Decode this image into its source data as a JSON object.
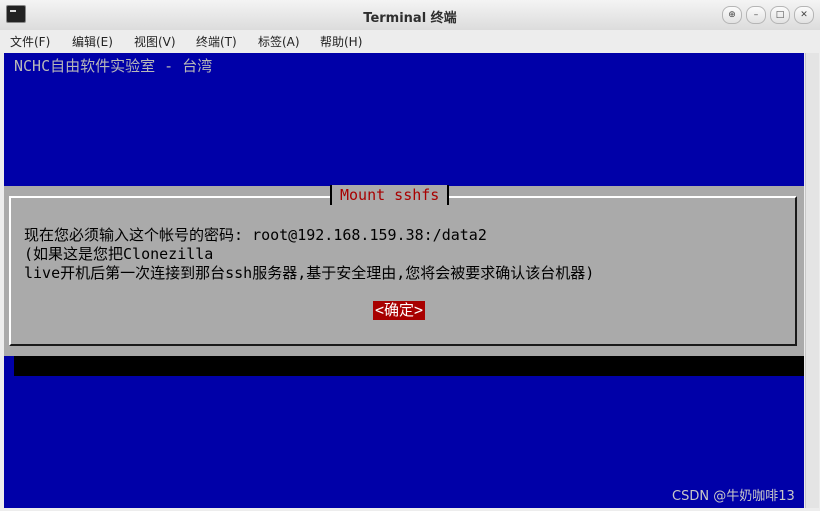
{
  "window": {
    "title": "Terminal 终端",
    "buttons": {
      "up": "⊕",
      "minimize": "–",
      "maximize": "□",
      "close": "✕"
    }
  },
  "menu": [
    "文件(F)",
    "编辑(E)",
    "视图(V)",
    "终端(T)",
    "标签(A)",
    "帮助(H)"
  ],
  "terminal": {
    "backtitle": "NCHC自由软件实验室 - 台湾",
    "dialog": {
      "title": "Mount sshfs",
      "lines": [
        "现在您必须输入这个帐号的密码: root@192.168.159.38:/data2",
        "(如果这是您把Clonezilla",
        "live开机后第一次连接到那台ssh服务器,基于安全理由,您将会被要求确认该台机器)"
      ],
      "ok_label": "<确定>"
    },
    "colors": {
      "background": "#0000a8",
      "dialog": "#aaaaaa",
      "accent": "#a80000"
    }
  },
  "watermark": "CSDN @牛奶咖啡13"
}
